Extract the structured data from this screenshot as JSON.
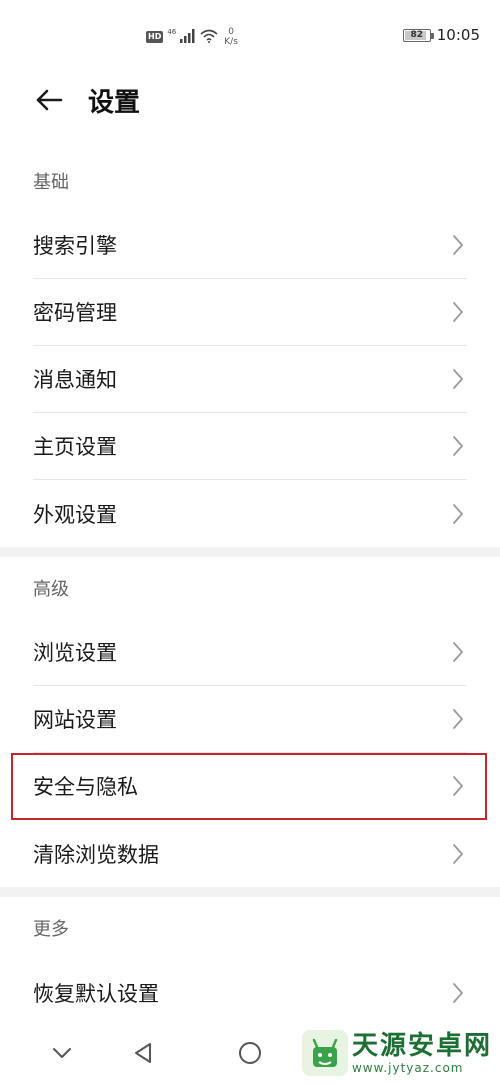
{
  "status_bar": {
    "hd_badge": "HD",
    "network_type": "46",
    "speed_value": "0",
    "speed_unit": "K/s",
    "battery_text": "82",
    "battery_level": 0.82,
    "time": "10:05"
  },
  "header": {
    "back_icon": "arrow-left-icon",
    "title": "设置"
  },
  "sections": [
    {
      "title": "基础",
      "items": [
        {
          "label": "搜索引擎"
        },
        {
          "label": "密码管理"
        },
        {
          "label": "消息通知"
        },
        {
          "label": "主页设置"
        },
        {
          "label": "外观设置"
        }
      ]
    },
    {
      "title": "高级",
      "items": [
        {
          "label": "浏览设置"
        },
        {
          "label": "网站设置"
        },
        {
          "label": "安全与隐私",
          "highlighted": true
        },
        {
          "label": "清除浏览数据"
        }
      ]
    },
    {
      "title": "更多",
      "items": [
        {
          "label": "恢复默认设置"
        }
      ]
    }
  ],
  "nav_bar": {
    "buttons": [
      "chevron-down-icon",
      "back-triangle-icon",
      "home-circle-icon"
    ]
  },
  "watermark": {
    "name": "天源安卓网",
    "url": "www.jytyaz.com"
  },
  "colors": {
    "highlight_border": "#c0282e",
    "divider": "#e6e6e6",
    "section_gap": "#f2f2f2",
    "watermark_green": "#1c6f33"
  }
}
